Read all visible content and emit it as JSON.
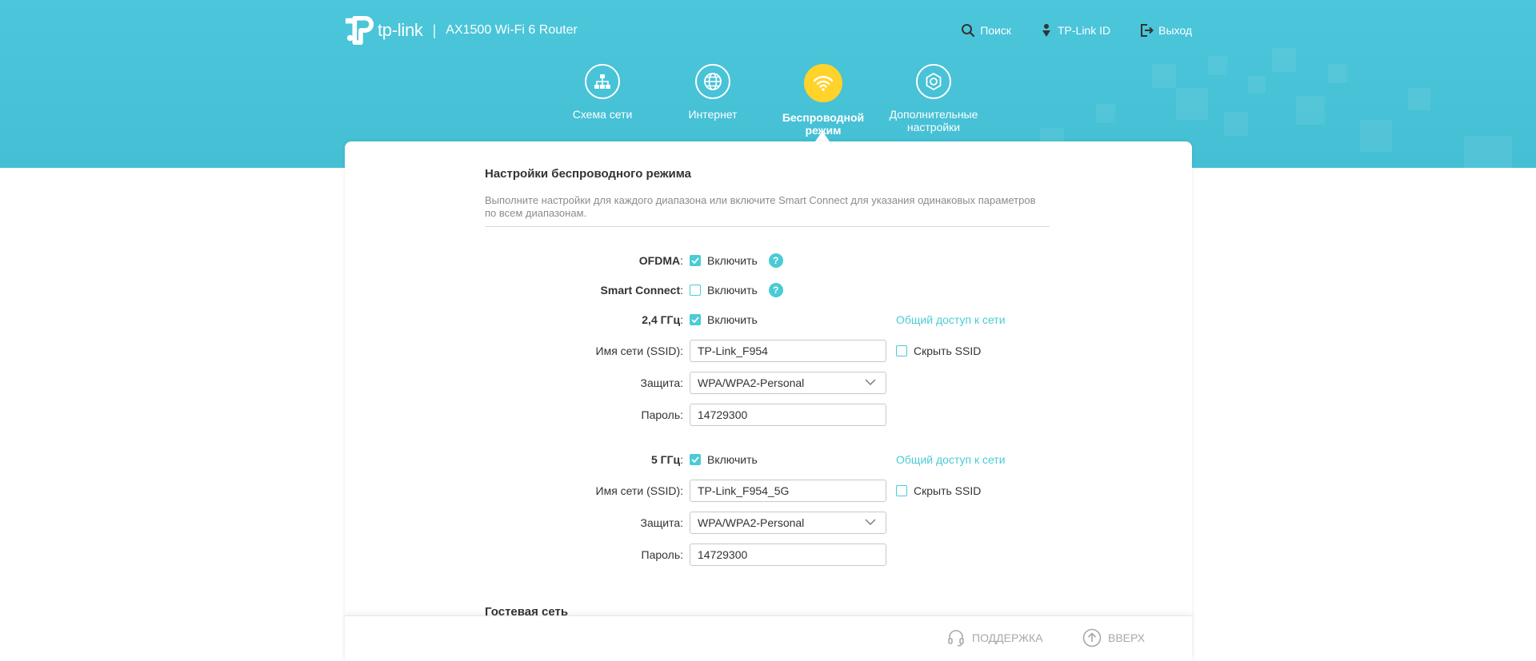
{
  "header": {
    "logo_text": "tp-link",
    "separator": "|",
    "model": "AX1500 Wi-Fi 6 Router",
    "actions": [
      {
        "label": "Поиск",
        "icon": "search-icon"
      },
      {
        "label": "TP-Link ID",
        "icon": "user-id-icon"
      },
      {
        "label": "Выход",
        "icon": "logout-icon"
      }
    ]
  },
  "nav": {
    "items": [
      {
        "label": "Схема сети",
        "icon": "network-map-icon"
      },
      {
        "label": "Интернет",
        "icon": "globe-icon"
      },
      {
        "label": "Беспроводной режим",
        "icon": "wifi-icon",
        "active": true
      },
      {
        "label": "Дополнительные настройки",
        "icon": "gear-icon"
      }
    ]
  },
  "wireless": {
    "title": "Настройки беспроводного режима",
    "description": "Выполните настройки для каждого диапазона или включите Smart Connect для указания одинаковых параметров по всем диапазонам.",
    "ofdma": {
      "label": "OFDMA",
      "colon": ":",
      "checkbox_label": "Включить",
      "checked": true
    },
    "smart_connect": {
      "label": "Smart Connect",
      "colon": ":",
      "checkbox_label": "Включить",
      "checked": false
    },
    "band24": {
      "label": "2,4 ГГц",
      "colon": ":",
      "checkbox_label": "Включить",
      "checked": true,
      "share_link": "Общий доступ к сети",
      "ssid_label": "Имя сети (SSID):",
      "ssid_value": "TP-Link_F954",
      "hide_ssid_label": "Скрыть SSID",
      "hide_ssid_checked": false,
      "security_label": "Защита:",
      "security_value": "WPA/WPA2-Personal",
      "password_label": "Пароль:",
      "password_value": "14729300"
    },
    "band5": {
      "label": "5 ГГц",
      "colon": ":",
      "checkbox_label": "Включить",
      "checked": true,
      "share_link": "Общий доступ к сети",
      "ssid_label": "Имя сети (SSID):",
      "ssid_value": "TP-Link_F954_5G",
      "hide_ssid_label": "Скрыть SSID",
      "hide_ssid_checked": false,
      "security_label": "Защита:",
      "security_value": "WPA/WPA2-Personal",
      "password_label": "Пароль:",
      "password_value": "14729300"
    }
  },
  "guest": {
    "title": "Гостевая сеть"
  },
  "footer": {
    "support_label": "ПОДДЕРЖКА",
    "top_label": "ВВЕРХ"
  },
  "colors": {
    "banner": "#4bc6da",
    "accent": "#4acbd6",
    "active_nav": "#ffd32a",
    "footer_text": "#a8a8a8"
  }
}
